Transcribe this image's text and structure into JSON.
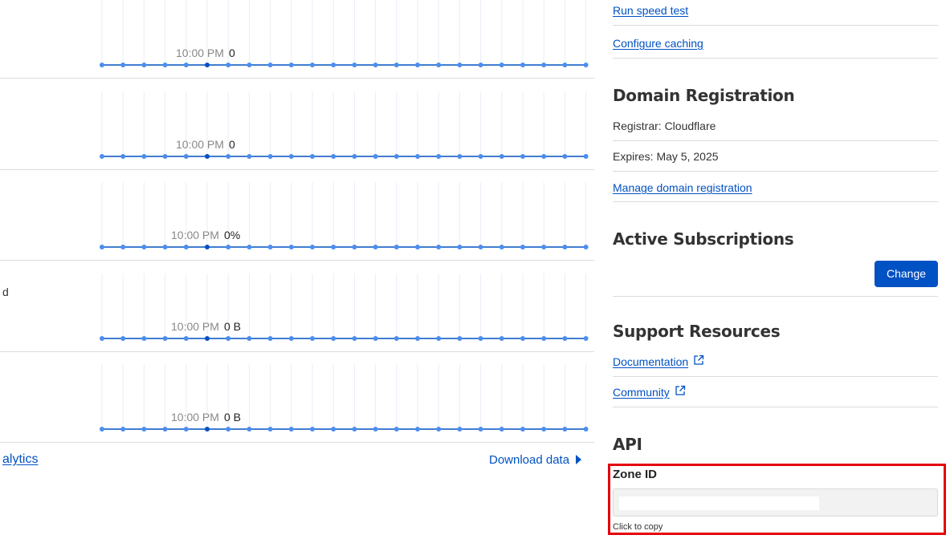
{
  "analytics": {
    "rows": [
      {
        "label": "",
        "tooltip_time": "10:00 PM",
        "tooltip_value": "0"
      },
      {
        "label": "",
        "tooltip_time": "10:00 PM",
        "tooltip_value": "0"
      },
      {
        "label": "",
        "tooltip_time": "10:00 PM",
        "tooltip_value": "0%"
      },
      {
        "label": "d",
        "tooltip_time": "10:00 PM",
        "tooltip_value": "0 B"
      },
      {
        "label": "",
        "tooltip_time": "10:00 PM",
        "tooltip_value": "0 B"
      }
    ],
    "point_count": 24,
    "highlight_index": 5,
    "line_color": "#0051c3",
    "point_color": "#4c8ef0",
    "highlight_point_color": "#0051c3",
    "left_link": "alytics",
    "download_label": "Download data"
  },
  "sidebar": {
    "speed_test_link": "Run speed test",
    "caching_link": "Configure caching",
    "domain_registration": {
      "heading": "Domain Registration",
      "registrar": "Registrar: Cloudflare",
      "expires": "Expires: May 5, 2025",
      "manage_link": "Manage domain registration"
    },
    "subscriptions": {
      "heading": "Active Subscriptions",
      "change_button": "Change"
    },
    "support": {
      "heading": "Support Resources",
      "documentation_link": "Documentation",
      "community_link": "Community"
    },
    "api": {
      "heading": "API",
      "zone_id_label": "Zone ID",
      "zone_id_value": "",
      "copy_hint": "Click to copy"
    }
  },
  "colors": {
    "accent": "#0051c3",
    "highlight_border": "#e5000a"
  }
}
